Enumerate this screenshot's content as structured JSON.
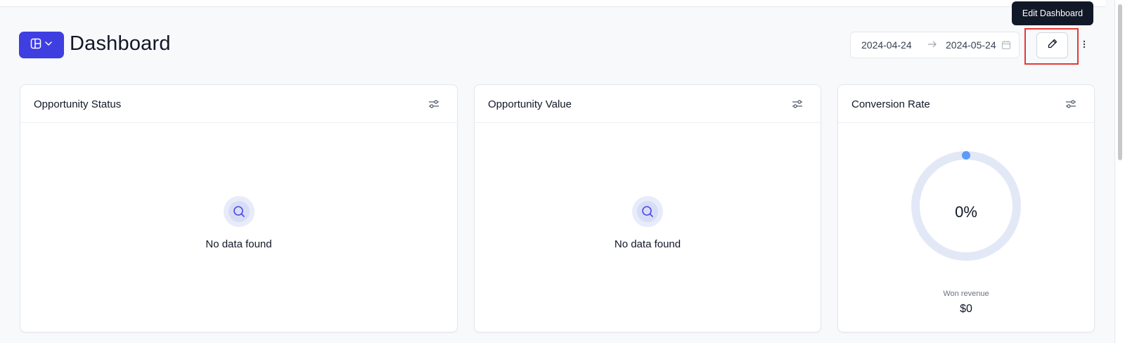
{
  "header": {
    "title": "Dashboard",
    "date_start": "2024-04-24",
    "date_separator": "→",
    "date_end": "2024-05-24",
    "edit_tooltip": "Edit Dashboard"
  },
  "colors": {
    "accent": "#3f3ee0",
    "highlight_border": "#e53935",
    "donut_track": "#e3e8f7",
    "donut_progress": "#5b9cf6"
  },
  "icons": {
    "view_switch": "layout-icon",
    "view_chevron": "chevron-down-icon",
    "calendar": "calendar-icon",
    "edit": "pencil-icon",
    "more": "more-vertical-icon",
    "filter": "sliders-icon",
    "empty": "search-icon"
  },
  "cards": [
    {
      "title": "Opportunity Status",
      "empty_text": "No data found"
    },
    {
      "title": "Opportunity Value",
      "empty_text": "No data found"
    },
    {
      "title": "Conversion Rate",
      "rate": "0%",
      "rate_fraction": 0,
      "won_label": "Won revenue",
      "won_value": "$0"
    }
  ]
}
